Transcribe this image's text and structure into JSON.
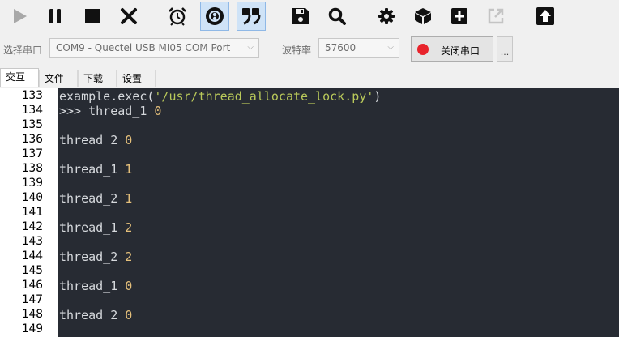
{
  "toolbar": {
    "buttons": [
      {
        "id": "run",
        "icon": "play-icon"
      },
      {
        "id": "pause",
        "icon": "pause-icon"
      },
      {
        "id": "stop",
        "icon": "stop-icon"
      },
      {
        "id": "close",
        "icon": "close-icon"
      },
      {
        "id": "alarm",
        "icon": "alarm-clock-icon"
      },
      {
        "id": "connect",
        "icon": "connection-icon",
        "active": true
      },
      {
        "id": "quote",
        "icon": "quote-icon",
        "active": true
      },
      {
        "id": "save",
        "icon": "save-icon"
      },
      {
        "id": "search",
        "icon": "search-icon"
      },
      {
        "id": "settings",
        "icon": "gear-icon"
      },
      {
        "id": "package",
        "icon": "cube-icon"
      },
      {
        "id": "add",
        "icon": "plus-icon"
      },
      {
        "id": "export",
        "icon": "external-link-icon",
        "disabled": true
      },
      {
        "id": "upload",
        "icon": "upload-arrow-icon"
      }
    ]
  },
  "settings": {
    "port_label": "选择串口",
    "port_value": "COM9 - Quectel USB MI05 COM Port",
    "baud_label": "波特率",
    "baud_value": "57600",
    "serial_button_label": "关闭串口",
    "more_label": "..."
  },
  "tabs": [
    {
      "label": "交互",
      "active": true
    },
    {
      "label": "文件"
    },
    {
      "label": "下载"
    },
    {
      "label": "设置"
    }
  ],
  "terminal": {
    "line_numbers": [
      "133",
      "134",
      "135",
      "136",
      "137",
      "138",
      "139",
      "140",
      "141",
      "142",
      "143",
      "144",
      "145",
      "146",
      "147",
      "148",
      "149"
    ],
    "lines": [
      {
        "pre": "example.exec(",
        "str": "'/usr/thread_allocate_lock.py'",
        "post": ")"
      },
      {
        "pre": ">>> thread_1 ",
        "num": "0"
      },
      {
        "pre": ""
      },
      {
        "pre": "thread_2 ",
        "num": "0"
      },
      {
        "pre": ""
      },
      {
        "pre": "thread_1 ",
        "num": "1"
      },
      {
        "pre": ""
      },
      {
        "pre": "thread_2 ",
        "num": "1"
      },
      {
        "pre": ""
      },
      {
        "pre": "thread_1 ",
        "num": "2"
      },
      {
        "pre": ""
      },
      {
        "pre": "thread_2 ",
        "num": "2"
      },
      {
        "pre": ""
      },
      {
        "pre": "thread_1 ",
        "num": "0"
      },
      {
        "pre": ""
      },
      {
        "pre": "thread_2 ",
        "num": "0"
      },
      {
        "pre": ""
      }
    ]
  },
  "colors": {
    "terminal_bg": "#272b33",
    "terminal_text": "#d6d9dd",
    "string": "#b9c95a",
    "number": "#e5c07b",
    "record_dot": "#e8232b",
    "active_button_bg": "#cfe3f7"
  }
}
